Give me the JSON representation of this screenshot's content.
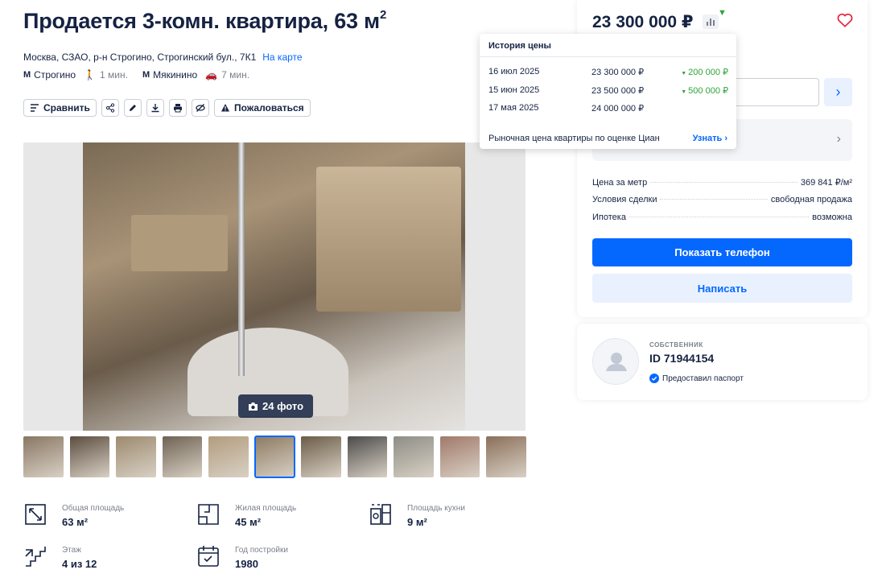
{
  "listing": {
    "title": "Продается 3-комн. квартира, 63 м",
    "title_sup": "2",
    "address": "Москва, СЗАО, р-н Строгино, Строгинский бул., 7К1",
    "map_link": "На карте",
    "metro": [
      {
        "name": "Строгино",
        "time": "1 мин.",
        "mode": "walk-icon"
      },
      {
        "name": "Мякинино",
        "time": "7 мин.",
        "mode": "car-icon"
      }
    ]
  },
  "toolbar": {
    "compare": "Сравнить",
    "complain": "Пожаловаться"
  },
  "gallery": {
    "photo_count": "24 фото",
    "thumb_colors": [
      "#8a7764",
      "#5c4d40",
      "#9d8a6f",
      "#6e6253",
      "#b39c7e",
      "#8d7b62",
      "#6b5c48",
      "#4c4b4a",
      "#8e8d86",
      "#a1796a",
      "#8b6f5a"
    ],
    "active_thumb": 5
  },
  "features": [
    {
      "label": "Общая площадь",
      "value": "63 м²",
      "icon": "area-icon"
    },
    {
      "label": "Жилая площадь",
      "value": "45 м²",
      "icon": "living-area-icon"
    },
    {
      "label": "Площадь кухни",
      "value": "9 м²",
      "icon": "kitchen-icon"
    },
    {
      "label": "Этаж",
      "value": "4 из 12",
      "icon": "stairs-icon"
    },
    {
      "label": "Год постройки",
      "value": "1980",
      "icon": "calendar-icon"
    }
  ],
  "offer": {
    "price": "23 300 000 ₽",
    "details": [
      {
        "key": "Цена за метр",
        "value": "369 841 ₽/м²"
      },
      {
        "key": "Условия сделки",
        "value": "свободная продажа"
      },
      {
        "key": "Ипотека",
        "value": "возможна"
      }
    ],
    "show_phone": "Показать телефон",
    "write": "Написать"
  },
  "owner": {
    "type": "СОБСТВЕННИК",
    "id": "ID 71944154",
    "passport": "Предоставил паспорт"
  },
  "price_history": {
    "title": "История цены",
    "rows": [
      {
        "date": "16 июл 2025",
        "price": "23 300 000 ₽",
        "change": "200 000 ₽"
      },
      {
        "date": "15 июн 2025",
        "price": "23 500 000 ₽",
        "change": "500 000 ₽"
      },
      {
        "date": "17 мая 2025",
        "price": "24 000 000 ₽",
        "change": ""
      }
    ],
    "footer": "Рыночная цена квартиры по оценке Циан",
    "footer_link": "Узнать"
  },
  "colors": {
    "accent": "#0468ff",
    "text": "#152242",
    "green": "#2ea43a",
    "muted": "#7a7f8a"
  }
}
